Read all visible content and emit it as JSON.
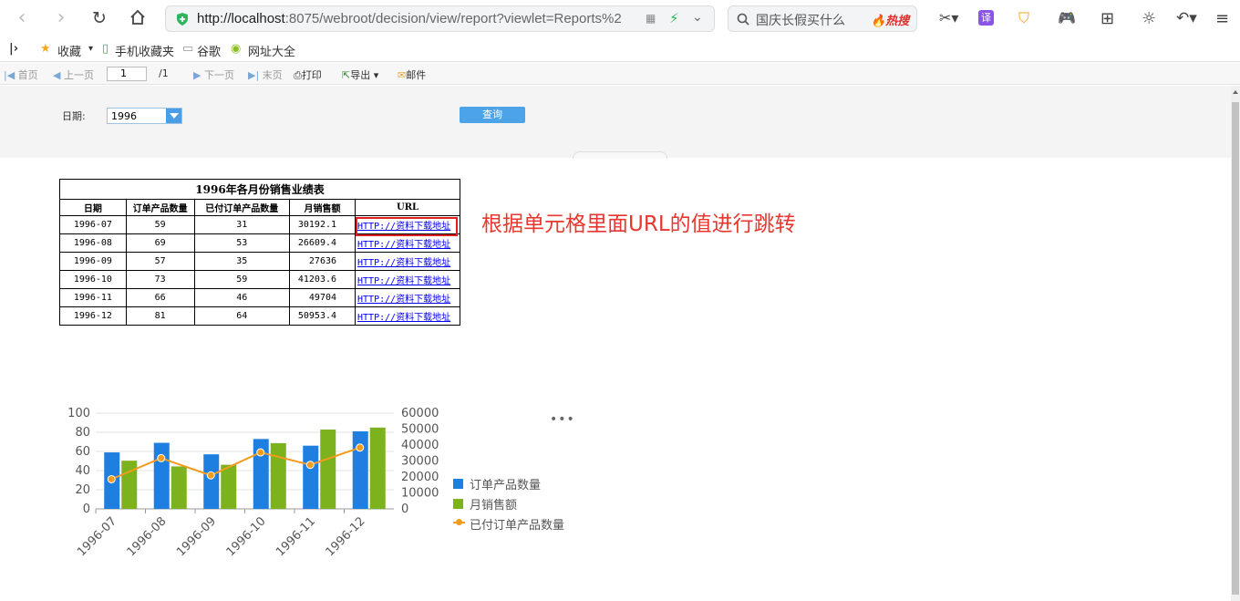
{
  "browser": {
    "url_host": "http://localhost",
    "url_rest": ":8075/webroot/decision/view/report?viewlet=Reports%2",
    "search_placeholder": "国庆长假买什么",
    "search_hot": "🔥热搜"
  },
  "bookmarks": [
    {
      "label": "收藏"
    },
    {
      "label": "手机收藏夹"
    },
    {
      "label": "谷歌"
    },
    {
      "label": "网址大全"
    }
  ],
  "report_toolbar": {
    "first": "首页",
    "prev": "上一页",
    "page_value": "1",
    "page_total": "/1",
    "next": "下一页",
    "last": "末页",
    "print": "打印",
    "export": "导出",
    "mail": "邮件"
  },
  "params": {
    "date_label": "日期:",
    "date_value": "1996",
    "query_label": "查询"
  },
  "table": {
    "title": "1996年各月份销售业绩表",
    "headers": [
      "日期",
      "订单产品数量",
      "已付订单产品数量",
      "月销售额",
      "URL"
    ],
    "rows": [
      [
        "1996-07",
        "59",
        "31",
        "30192.1",
        "HTTP://资料下载地址"
      ],
      [
        "1996-08",
        "69",
        "53",
        "26609.4",
        "HTTP://资料下载地址"
      ],
      [
        "1996-09",
        "57",
        "35",
        "27636",
        "HTTP://资料下载地址"
      ],
      [
        "1996-10",
        "73",
        "59",
        "41203.6",
        "HTTP://资料下载地址"
      ],
      [
        "1996-11",
        "66",
        "46",
        "49704",
        "HTTP://资料下载地址"
      ],
      [
        "1996-12",
        "81",
        "64",
        "50953.4",
        "HTTP://资料下载地址"
      ]
    ]
  },
  "annotation": "根据单元格里面URL的值进行跳转",
  "chart_data": {
    "type": "bar",
    "categories": [
      "1996-07",
      "1996-08",
      "1996-09",
      "1996-10",
      "1996-11",
      "1996-12"
    ],
    "series": [
      {
        "name": "订单产品数量",
        "type": "bar",
        "axis": "left",
        "values": [
          59,
          69,
          57,
          73,
          66,
          81
        ],
        "color": "#1f7fe0"
      },
      {
        "name": "月销售额",
        "type": "bar",
        "axis": "right",
        "values": [
          30192.1,
          26609.4,
          27636,
          41203.6,
          49704,
          50953.4
        ],
        "color": "#7bb21e"
      },
      {
        "name": "已付订单产品数量",
        "type": "line",
        "axis": "left",
        "values": [
          31,
          53,
          35,
          59,
          46,
          64
        ],
        "color": "#f29b1d"
      }
    ],
    "y_left": {
      "min": 0,
      "max": 100,
      "ticks": [
        "0",
        "20",
        "40",
        "60",
        "80",
        "100"
      ]
    },
    "y_right": {
      "min": 0,
      "max": 60000,
      "ticks": [
        "0",
        "10000",
        "20000",
        "30000",
        "40000",
        "50000",
        "60000"
      ]
    },
    "legend_position": "right",
    "grid": true
  }
}
